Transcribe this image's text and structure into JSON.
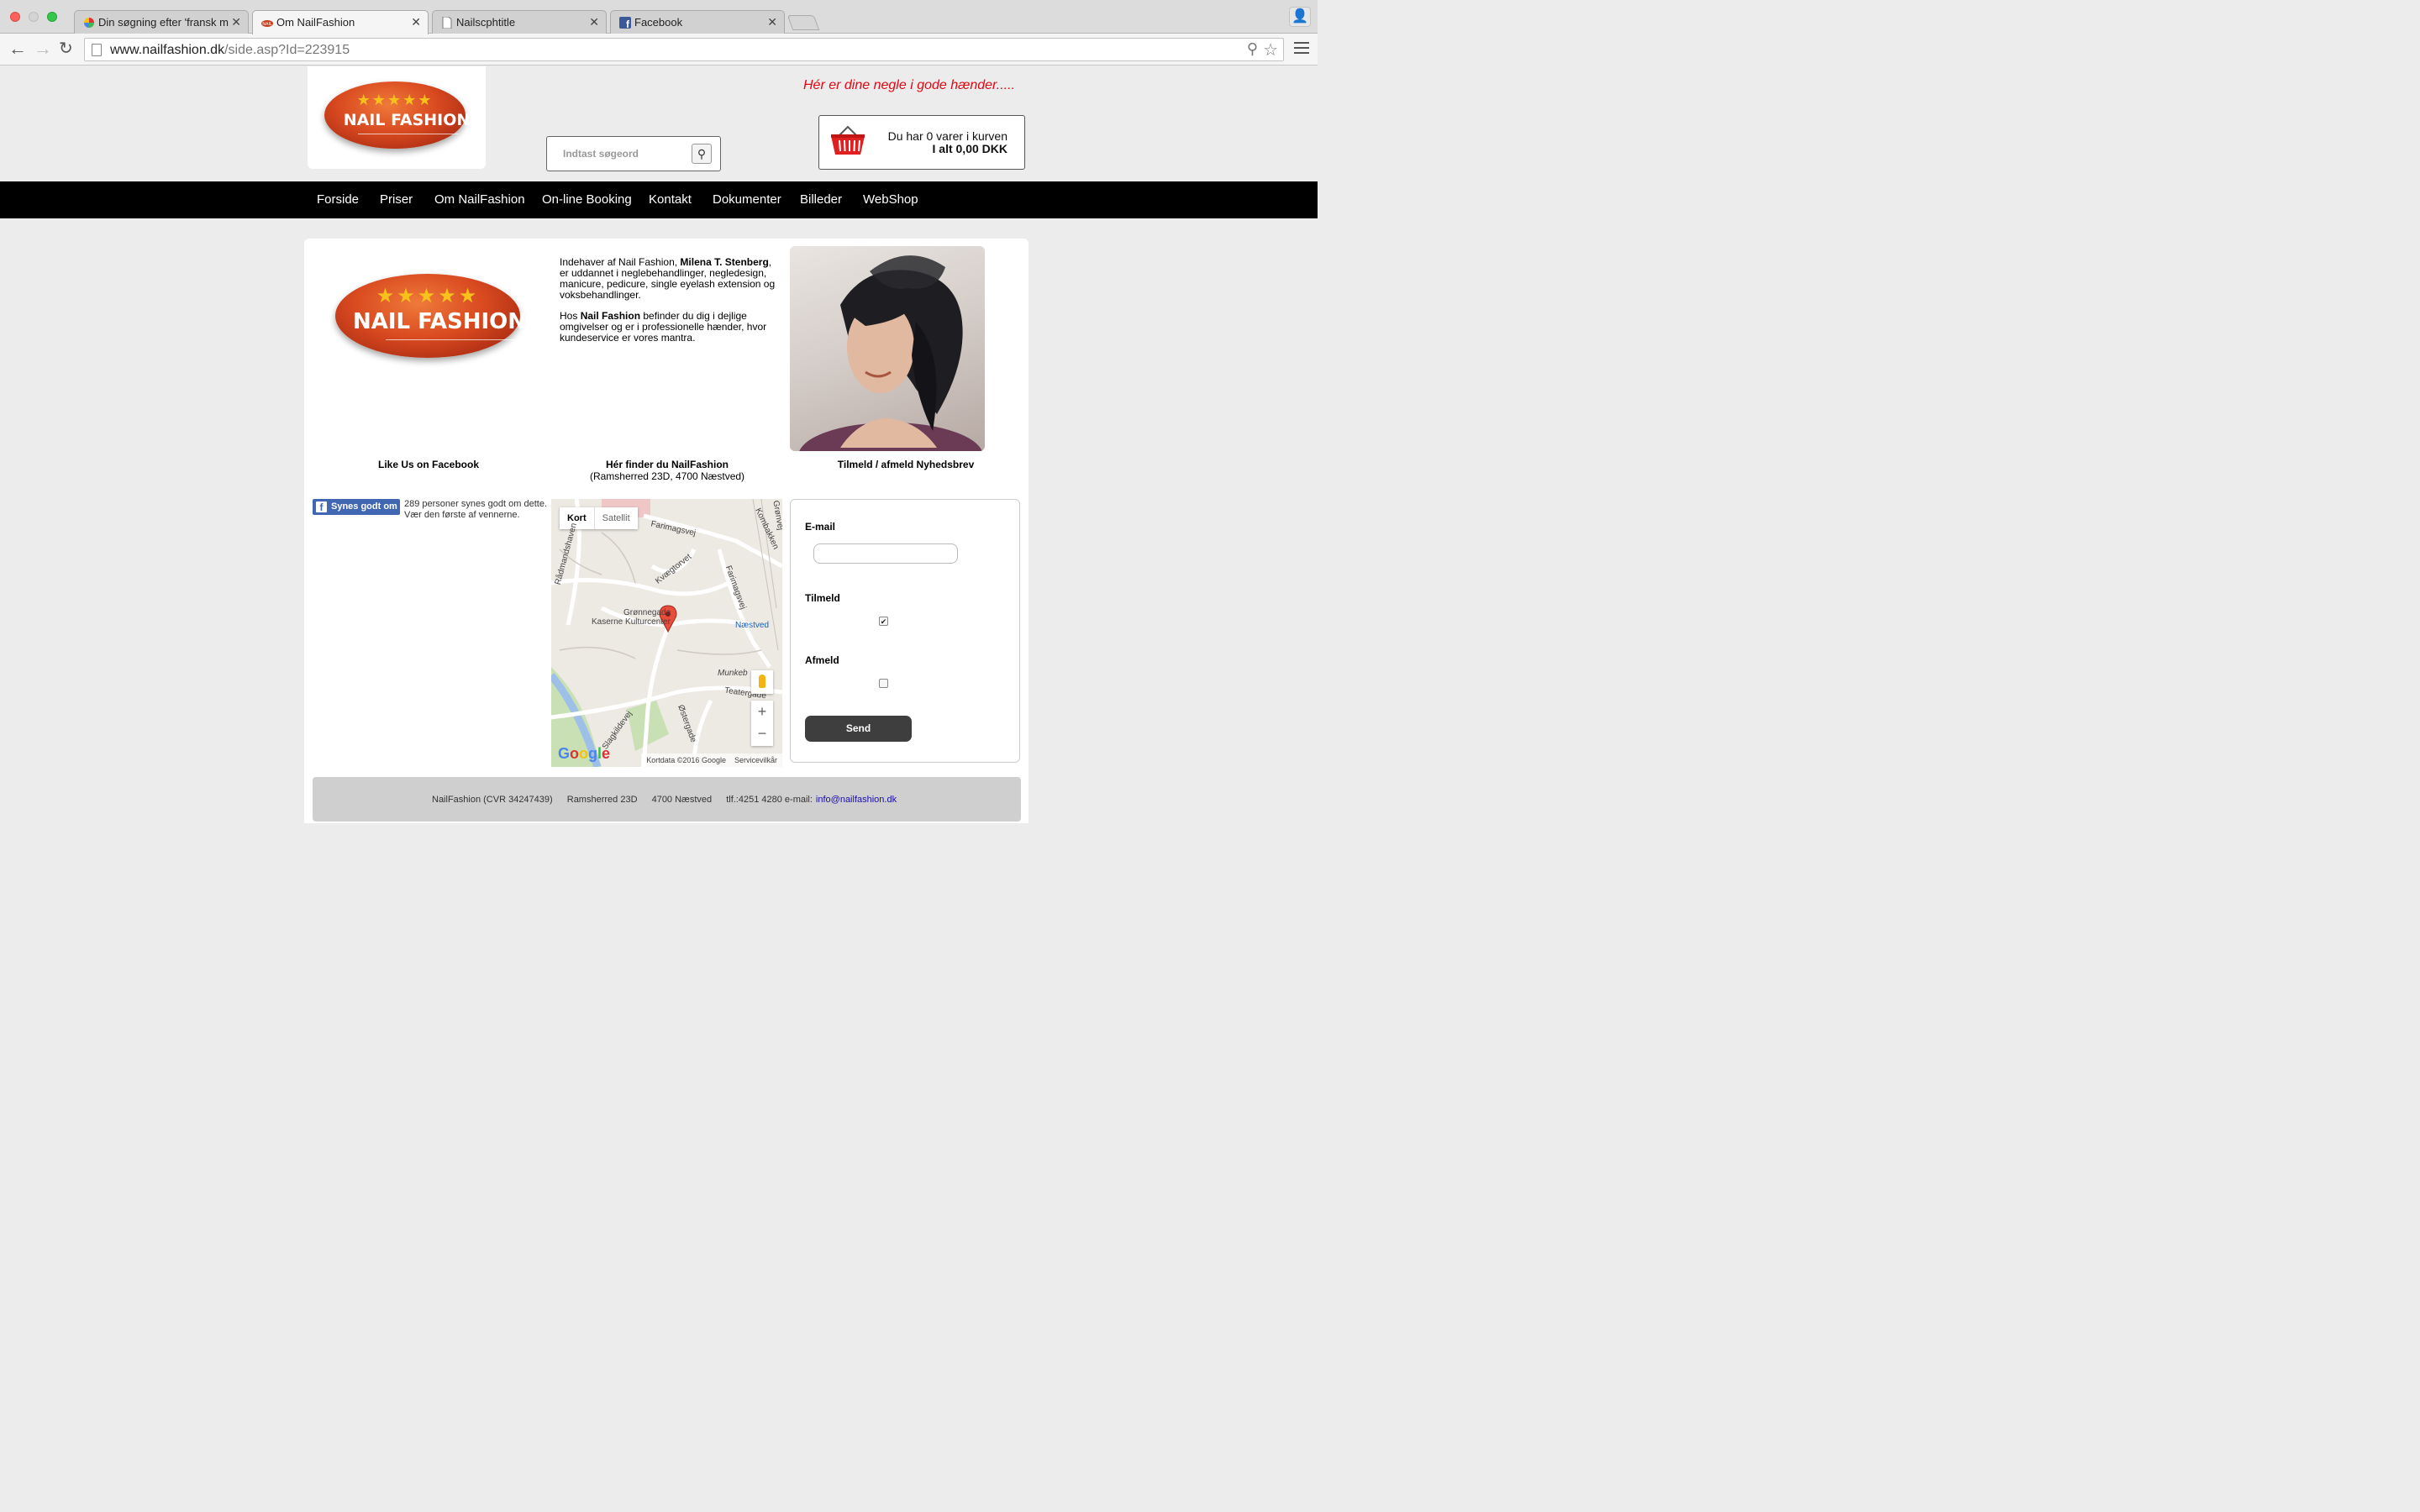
{
  "browser": {
    "tabs": [
      {
        "title": "Din søgning efter 'fransk m",
        "active": false
      },
      {
        "title": "Om NailFashion",
        "active": true
      },
      {
        "title": "Nailscphtitle",
        "active": false
      },
      {
        "title": "Facebook",
        "active": false
      }
    ],
    "url_host": "www.nailfashion.dk",
    "url_path": "/side.asp?Id=223915"
  },
  "header": {
    "logo_text": "NAIL FASHION",
    "logo_stars": "★★★★★",
    "slogan": "Hér er dine negle i gode hænder.....",
    "search_placeholder": "Indtast søgeord",
    "cart_line1": "Du har 0 varer i kurven",
    "cart_line2": "I alt 0,00 DKK"
  },
  "nav": [
    "Forside",
    "Priser",
    "Om NailFashion",
    "On-line Booking",
    "Kontakt",
    "Dokumenter",
    "Billeder",
    "WebShop"
  ],
  "intro": {
    "p1_before": "Indehaver af Nail Fashion, ",
    "p1_name": "Milena T. Stenberg",
    "p1_after": ", er uddannet i neglebehandlinger, negledesign, manicure, pedicure, single eyelash extension og voksbehandlinger.",
    "p2_before": "Hos ",
    "p2_brand": "Nail Fashion",
    "p2_after": " befinder du dig i dejlige omgivelser og er i professionelle hænder, hvor kundeservice er vores mantra."
  },
  "captions": {
    "facebook": "Like Us on Facebook",
    "map_title": "Hér finder du NailFashion",
    "map_address": "(Ramsherred 23D, 4700 Næstved)",
    "newsletter": "Tilmeld / afmeld Nyhedsbrev"
  },
  "facebook": {
    "button": "Synes godt om",
    "text": "289 personer synes godt om dette. Vær den første af vennerne."
  },
  "map": {
    "tab_map": "Kort",
    "tab_satellite": "Satellit",
    "labels": [
      "Farimagsvej",
      "Kvægtorvet",
      "Farimagsvej",
      "Grønnegade",
      "Kaserne Kulturcenter",
      "Næstved",
      "Munkeb",
      "Teatergade",
      "Østergade",
      "Slagkildevej",
      "Kombakken",
      "Grønvej",
      "Rådmandshaven"
    ],
    "google": "Google",
    "footer_data": "Kortdata ©2016 Google",
    "footer_terms": "Servicevilkår"
  },
  "newsletter": {
    "email_label": "E-mail",
    "subscribe_label": "Tilmeld",
    "unsubscribe_label": "Afmeld",
    "subscribe_checked": true,
    "unsubscribe_checked": false,
    "send": "Send"
  },
  "footer": {
    "company": "NailFashion (CVR 34247439)",
    "street": "Ramsherred 23D",
    "city": "4700 Næstved",
    "contact": "tlf.:4251 4280 e-mail:",
    "email": "info@nailfashion.dk"
  },
  "colors": {
    "slogan": "#e30613",
    "navbar": "#000000",
    "facebook": "#4267b2"
  }
}
